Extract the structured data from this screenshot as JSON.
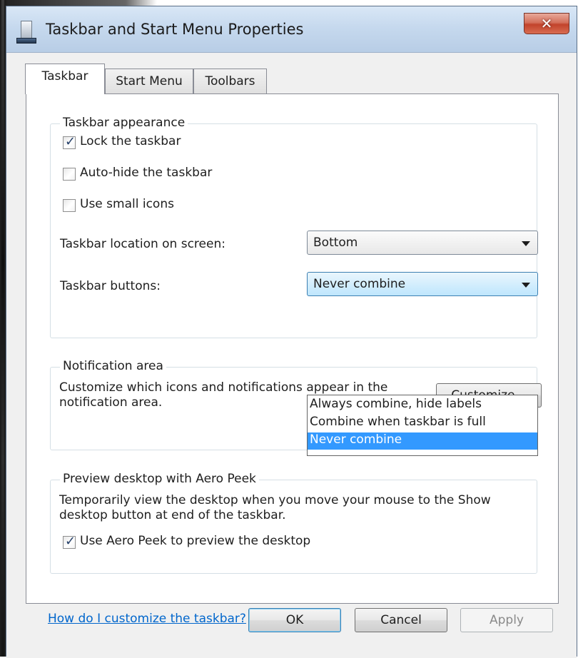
{
  "window": {
    "title": "Taskbar and Start Menu Properties",
    "close_glyph": "✕"
  },
  "tabs": [
    {
      "label": "Taskbar",
      "active": true
    },
    {
      "label": "Start Menu",
      "active": false
    },
    {
      "label": "Toolbars",
      "active": false
    }
  ],
  "appearance": {
    "legend": "Taskbar appearance",
    "lock": {
      "label": "Lock the taskbar",
      "checked": true
    },
    "autohide": {
      "label": "Auto-hide the taskbar",
      "checked": false
    },
    "small_icons": {
      "label": "Use small icons",
      "checked": false
    },
    "location_label": "Taskbar location on screen:",
    "location_value": "Bottom",
    "buttons_label": "Taskbar buttons:",
    "buttons_value": "Never combine",
    "buttons_options": [
      "Always combine, hide labels",
      "Combine when taskbar is full",
      "Never combine"
    ]
  },
  "notification": {
    "legend": "Notification area",
    "text": "Customize which icons and notifications appear in the notification area.",
    "customize_label": "Customize..."
  },
  "peek": {
    "legend": "Preview desktop with Aero Peek",
    "text": "Temporarily view the desktop when you move your mouse to the Show desktop button at end of the taskbar.",
    "checkbox": {
      "label": "Use Aero Peek to preview the desktop",
      "checked": true
    }
  },
  "help_link": "How do I customize the taskbar?",
  "buttons": {
    "ok": "OK",
    "cancel": "Cancel",
    "apply": "Apply"
  },
  "colors": {
    "selection": "#3399ff",
    "link": "#0066cc",
    "close_button": "#c2432c"
  },
  "check_glyph": "✓"
}
